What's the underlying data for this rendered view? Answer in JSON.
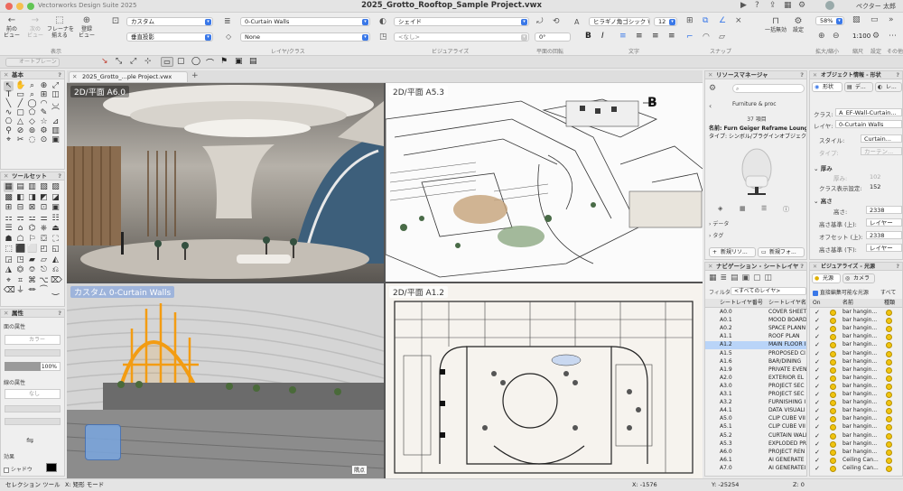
{
  "window": {
    "app_name": "Vectorworks Design Suite 2025",
    "document_title": "2025_Grotto_Rooftop_Sample Project.vwx",
    "user": "ペクター 太郎"
  },
  "toolbar": {
    "prev_view": "前の\nビュー",
    "next_view": "次の\nビュー",
    "flyover": "フレーナを\n揃える",
    "register_view": "登録\nビュー",
    "group_view": "表示",
    "class_value": "カスタム",
    "layer_value": "0-Curtain Walls",
    "view_value": "垂直投影",
    "layer_sub_value": "None",
    "group_layer_class": "レイヤ/クラス",
    "render_value": "シェイド",
    "render_sub_value": "<なし>",
    "group_visualize": "ビジュアライズ",
    "rotation_value": "0°",
    "group_plane_rotation": "平面の回転",
    "font_value": "ヒラギノ角ゴシック W3",
    "font_size_value": "12",
    "group_text": "文字",
    "group_snap": "スナップ",
    "one_click": "一括無効",
    "settings": "設定",
    "zoom_value": "58%",
    "scale_value": "1:100",
    "group_zoom": "拡大/縮小",
    "group_scale": "縮尺",
    "group_settings2": "設定",
    "group_misc": "その他"
  },
  "modebar": {
    "autoplane": "オートプレーン"
  },
  "tabs": [
    {
      "label": "2025_Grotto_...ple Project.vwx"
    }
  ],
  "panels": {
    "basic": {
      "title": "基本"
    },
    "toolsets": {
      "title": "ツールセット"
    },
    "attributes": {
      "title": "属性",
      "fill_label": "面の属性",
      "fill_value": "カラー",
      "opacity_value": "100%",
      "line_label": "線の属性",
      "line_value": "なし",
      "effect_label": "効果",
      "shadow_label": "シャドウ"
    },
    "resource_manager": {
      "title": "リソースマネージャ",
      "path": "Furniture & proc",
      "count": "37 項目",
      "name": "名前: Furn Geiger Reframe Lounge...",
      "type": "タイプ: シンボル/プラグインオブジェクト",
      "data_label": "データ",
      "tag_label": "タグ",
      "new_resource": "新規リソ...",
      "new_folder": "新規フォ..."
    },
    "object_info": {
      "title": "オブジェクト情報 - 形状",
      "tab_shape": "形状",
      "tab_data": "デ...",
      "tab_render": "レ...",
      "class_label": "クラス:",
      "class_value": "A_EF-Wall-Curtain...",
      "layer_label": "レイヤ:",
      "layer_value": "0-Curtain Walls",
      "style_label": "スタイル:",
      "style_value": "Curtain...",
      "type_label": "タイプ:",
      "type_value": "カーテン...",
      "thickness_label": "厚み",
      "thickness_sub": "厚み:",
      "thickness_value": "102",
      "class_display_label": "クラス表示設定:",
      "class_display_value": "152",
      "height_label": "高さ",
      "height_sub": "高さ:",
      "height_value": "2338",
      "base_top_label": "高さ基準 (上):",
      "base_top_value": "レイヤー",
      "offset_top_label": "オフセット (上):",
      "offset_top_value": "2338",
      "base_bottom_label": "高さ基準 (下):",
      "base_bottom_value": "レイヤー"
    },
    "navigation": {
      "title": "ナビゲーション - シートレイヤ",
      "filter_label": "フィルタ:",
      "filter_value": "<すべてのレイヤ>",
      "col_number": "シートレイヤ番号",
      "col_name": "シートレイヤ名",
      "rows": [
        {
          "num": "A0.0",
          "name": "COVER SHEET"
        },
        {
          "num": "A0.1",
          "name": "MOOD BOARD"
        },
        {
          "num": "A0.2",
          "name": "SPACE PLANN"
        },
        {
          "num": "A1.1",
          "name": "ROOF PLAN"
        },
        {
          "num": "A1.2",
          "name": "MAIN FLOOR I"
        },
        {
          "num": "A1.5",
          "name": "PROPOSED CI"
        },
        {
          "num": "A1.6",
          "name": "BAR/DINING"
        },
        {
          "num": "A1.9",
          "name": "PRIVATE EVEN"
        },
        {
          "num": "A2.0",
          "name": "EXTERIOR EL"
        },
        {
          "num": "A3.0",
          "name": "PROJECT SEC"
        },
        {
          "num": "A3.1",
          "name": "PROJECT SEC"
        },
        {
          "num": "A3.2",
          "name": "FURNISHING I"
        },
        {
          "num": "A4.1",
          "name": "DATA VISUALI"
        },
        {
          "num": "A5.0",
          "name": "CLIP CUBE VII"
        },
        {
          "num": "A5.1",
          "name": "CLIP CUBE VII"
        },
        {
          "num": "A5.2",
          "name": "CURTAIN WALL"
        },
        {
          "num": "A5.3",
          "name": "EXPLODED PR"
        },
        {
          "num": "A6.0",
          "name": "PROJECT REN"
        },
        {
          "num": "A6.1",
          "name": "AI GENERATE"
        },
        {
          "num": "A7.0",
          "name": "AI GENERATEI"
        }
      ]
    },
    "visualize": {
      "title": "ビジュアライズ - 光源",
      "tab_light": "光源",
      "tab_camera": "カメラ",
      "direct_label": "直接編集可能な光源",
      "all_label": "すべて",
      "col_on": "On",
      "col_name": "名前",
      "col_type": "種類",
      "rows": [
        "bar hangin...",
        "bar hangin...",
        "bar hangin...",
        "bar hangin...",
        "bar hangin...",
        "bar hangin...",
        "bar hangin...",
        "bar hangin...",
        "bar hangin...",
        "bar hangin...",
        "bar hangin...",
        "bar hangin...",
        "bar hangin...",
        "bar hangin...",
        "bar hangin...",
        "bar hangin...",
        "bar hangin...",
        "bar hangin...",
        "Ceiling Can...",
        "Ceiling Can..."
      ]
    }
  },
  "viewports": {
    "tl_label": "2D/平面  A6.0",
    "tr_label": "2D/平面  A5.3",
    "tr_marker": "B",
    "bl_label": "カスタム  0-Curtain Walls",
    "bl_badge": "隅点",
    "br_label": "2D/平面  A1.2"
  },
  "status": {
    "tool": "セレクション ツール",
    "mode": "X: 矩形 モード",
    "x": "X: -1576",
    "y": "Y: -25254",
    "z": "Z: 0"
  },
  "colors": {
    "accent": "#3a78e8",
    "selection_orange": "#f39c12",
    "selected_row": "#b9d4f8"
  }
}
